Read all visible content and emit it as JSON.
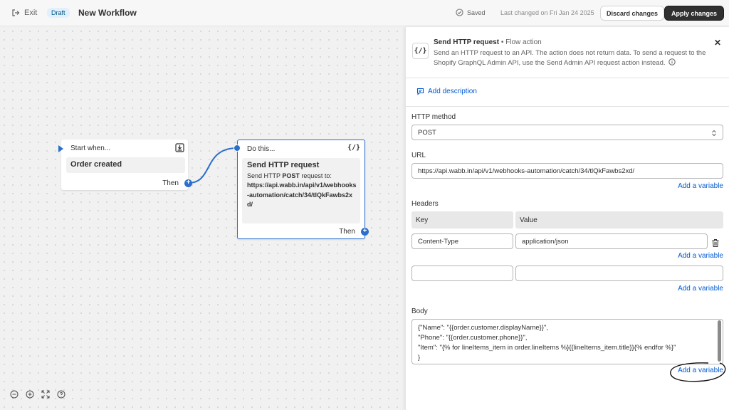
{
  "topbar": {
    "exit_label": "Exit",
    "draft_badge": "Draft",
    "title": "New Workflow",
    "saved_label": "Saved",
    "last_changed": "Last changed on Fri Jan 24 2025",
    "discard_label": "Discard changes",
    "apply_label": "Apply changes"
  },
  "canvas": {
    "start_node": {
      "header": "Start when...",
      "trigger": "Order created",
      "then_label": "Then"
    },
    "action_node": {
      "header": "Do this...",
      "title": "Send HTTP request",
      "desc_prefix": "Send HTTP ",
      "method": "POST",
      "desc_suffix": " request to:",
      "url": "https://api.wabb.in/api/v1/webhooks-automation/catch/34/tlQkFawbs2xd/",
      "then_label": "Then"
    },
    "accent_color": "#2c6ecb"
  },
  "panel": {
    "title": "Send HTTP request",
    "kind": "Flow action",
    "description": "Send an HTTP request to an API. The action does not return data. To send a request to the Shopify GraphQL Admin API, use the Send Admin API request action instead.",
    "add_description": "Add description",
    "http_method_label": "HTTP method",
    "http_method_value": "POST",
    "url_label": "URL",
    "url_value": "https://api.wabb.in/api/v1/webhooks-automation/catch/34/tlQkFawbs2xd/",
    "add_variable": "Add a variable",
    "headers_label": "Headers",
    "headers_columns": [
      "Key",
      "Value"
    ],
    "headers_rows": [
      {
        "key": "Content-Type",
        "value": "application/json"
      },
      {
        "key": "",
        "value": ""
      }
    ],
    "body_label": "Body",
    "body_value": "{\"Name\": \"{{order.customer.displayName}}\",\n\"Phone\": \"{{order.customer.phone}}\",\n\"Item\": \"{% for lineItems_item in order.lineItems %}{{lineItems_item.title}}{% endfor %}\"\n}",
    "link_color": "#005bd3"
  }
}
